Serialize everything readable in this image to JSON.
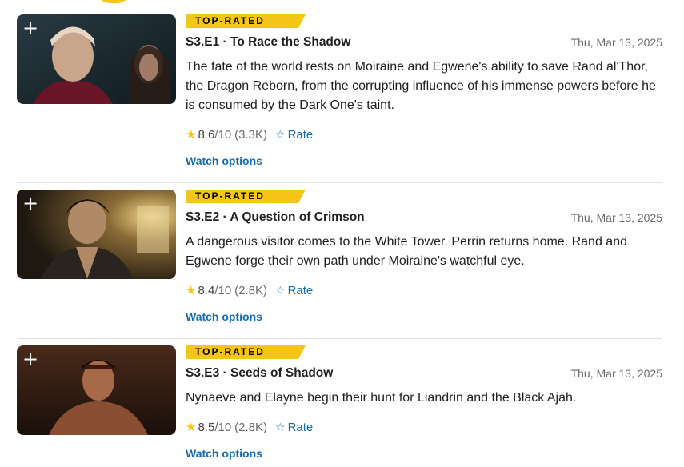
{
  "episodes": [
    {
      "badge": "TOP-RATED",
      "title": "S3.E1 · To Race the Shadow",
      "date": "Thu, Mar 13, 2025",
      "description": "The fate of the world rests on Moiraine and Egwene's ability to save Rand al'Thor, the Dragon Reborn, from the corrupting influence of his immense powers before he is consumed by the Dark One's taint.",
      "score": "8.6",
      "max": "/10",
      "count": "(3.3K)",
      "rate_label": "Rate",
      "watch_label": "Watch options",
      "add_label": "+"
    },
    {
      "badge": "TOP-RATED",
      "title": "S3.E2 · A Question of Crimson",
      "date": "Thu, Mar 13, 2025",
      "description": "A dangerous visitor comes to the White Tower. Perrin returns home. Rand and Egwene forge their own path under Moiraine's watchful eye.",
      "score": "8.4",
      "max": "/10",
      "count": "(2.8K)",
      "rate_label": "Rate",
      "watch_label": "Watch options",
      "add_label": "+"
    },
    {
      "badge": "TOP-RATED",
      "title": "S3.E3 · Seeds of Shadow",
      "date": "Thu, Mar 13, 2025",
      "description": "Nynaeve and Elayne begin their hunt for Liandrin and the Black Ajah.",
      "score": "8.5",
      "max": "/10",
      "count": "(2.8K)",
      "rate_label": "Rate",
      "watch_label": "Watch options",
      "add_label": "+"
    }
  ],
  "colors": {
    "accent": "#f5c518",
    "link": "#136cb2",
    "muted": "#6b6b6b"
  },
  "icons": {
    "rating": "star-filled-icon",
    "rate": "star-outline-icon",
    "add": "plus-icon"
  }
}
